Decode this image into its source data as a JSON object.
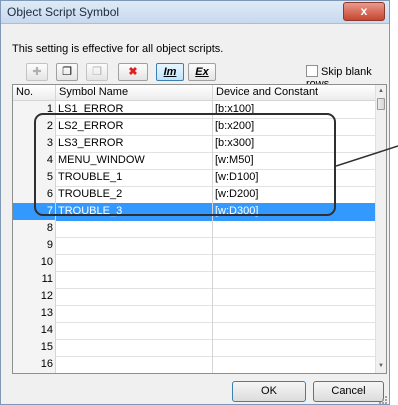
{
  "window": {
    "title": "Object Script Symbol",
    "close_glyph": "x"
  },
  "description": "This setting is effective for all object scripts.",
  "toolbar": {
    "buttons": [
      {
        "icon": "plus-icon",
        "glyph": "✚"
      },
      {
        "icon": "copy-icon",
        "glyph": "❐"
      },
      {
        "icon": "paste-icon",
        "glyph": "❒"
      },
      {
        "icon": "delete-icon",
        "glyph": "✖",
        "color": "#e02020"
      },
      {
        "icon": "import-icon",
        "label": "Im"
      },
      {
        "icon": "export-icon",
        "label": "Ex"
      }
    ],
    "skip_blank_rows": {
      "label": "Skip blank rows",
      "checked": false
    }
  },
  "table": {
    "columns": [
      "No.",
      "Symbol Name",
      "Device and Constant"
    ],
    "rows": [
      {
        "no": "1",
        "name": "LS1_ERROR",
        "device": "[b:x100]"
      },
      {
        "no": "2",
        "name": "LS2_ERROR",
        "device": "[b:x200]"
      },
      {
        "no": "3",
        "name": "LS3_ERROR",
        "device": "[b:x300]"
      },
      {
        "no": "4",
        "name": "MENU_WINDOW",
        "device": "[w:M50]"
      },
      {
        "no": "5",
        "name": "TROUBLE_1",
        "device": "[w:D100]"
      },
      {
        "no": "6",
        "name": "TROUBLE_2",
        "device": "[w:D200]"
      },
      {
        "no": "7",
        "name": "TROUBLE_3",
        "device": "[w:D300]",
        "selected": true
      },
      {
        "no": "8",
        "name": "",
        "device": ""
      },
      {
        "no": "9",
        "name": "",
        "device": ""
      },
      {
        "no": "10",
        "name": "",
        "device": ""
      },
      {
        "no": "11",
        "name": "",
        "device": ""
      },
      {
        "no": "12",
        "name": "",
        "device": ""
      },
      {
        "no": "13",
        "name": "",
        "device": ""
      },
      {
        "no": "14",
        "name": "",
        "device": ""
      },
      {
        "no": "15",
        "name": "",
        "device": ""
      },
      {
        "no": "16",
        "name": "",
        "device": ""
      }
    ]
  },
  "buttons": {
    "ok": "OK",
    "cancel": "Cancel"
  },
  "colors": {
    "selection": "#3399ff",
    "callout": "#2f2f2f"
  }
}
